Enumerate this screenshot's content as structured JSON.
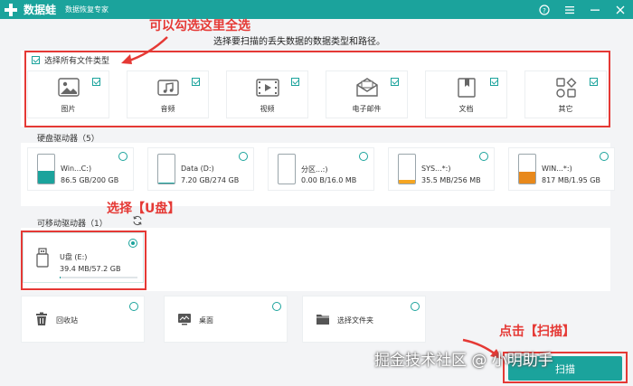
{
  "app": {
    "name": "数据蛙",
    "subtitle": "数据恢复专家",
    "brand_color": "#1ba39c"
  },
  "window_controls": [
    "help-icon",
    "menu-icon",
    "minimize-icon",
    "close-icon"
  ],
  "instruction": "选择要扫描的丢失数据的数据类型和路径。",
  "file_types": {
    "select_all_label": "选择所有文件类型",
    "items": [
      {
        "label": "图片",
        "icon": "image-icon"
      },
      {
        "label": "音频",
        "icon": "music-icon"
      },
      {
        "label": "视频",
        "icon": "video-icon"
      },
      {
        "label": "电子邮件",
        "icon": "email-icon"
      },
      {
        "label": "文档",
        "icon": "document-icon"
      },
      {
        "label": "其它",
        "icon": "other-icon"
      }
    ]
  },
  "hard_drives": {
    "label": "硬盘驱动器（5）",
    "items": [
      {
        "name": "Win...C:)",
        "size": "86.5 GB/200 GB",
        "fill_pct": 43,
        "color": "#1ba39c"
      },
      {
        "name": "Data (D:)",
        "size": "7.20 GB/274 GB",
        "fill_pct": 3,
        "color": "#1ba39c"
      },
      {
        "name": "分区...:)",
        "size": "0.00  B/16.0 MB",
        "fill_pct": 0,
        "color": "#f5a623"
      },
      {
        "name": "SYS...*:)",
        "size": "35.5 MB/256 MB",
        "fill_pct": 14,
        "color": "#f5a623"
      },
      {
        "name": "WIN...*:)",
        "size": "817 MB/1.95 GB",
        "fill_pct": 42,
        "color": "#e8891c"
      }
    ]
  },
  "removable": {
    "label": "可移动驱动器（1）",
    "items": [
      {
        "name": "U盘 (E:)",
        "size": "39.4 MB/57.2 GB",
        "fill_pct": 1
      }
    ]
  },
  "locations": [
    {
      "label": "回收站",
      "icon": "recycle-bin-icon"
    },
    {
      "label": "桌面",
      "icon": "desktop-icon"
    },
    {
      "label": "选择文件夹",
      "icon": "folder-icon"
    }
  ],
  "scan_label": "扫描",
  "annotations": {
    "select_all_hint": "可以勾选这里全选",
    "usb_hint": "选择【U盘】",
    "scan_hint": "点击【扫描】"
  },
  "watermark": "掘金技术社区 @ 小明助手"
}
